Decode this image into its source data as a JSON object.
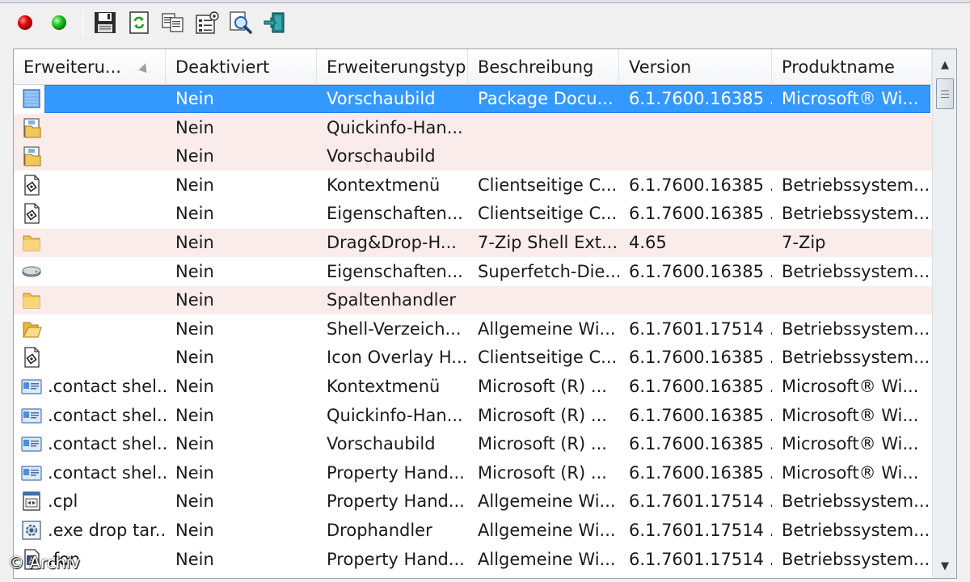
{
  "toolbar": {
    "buttons": [
      {
        "name": "disable-button",
        "icon": "red-dot-icon",
        "color": "#d40000"
      },
      {
        "name": "enable-button",
        "icon": "green-dot-icon",
        "color": "#16b216"
      },
      {
        "name": "save-button",
        "icon": "floppy-disk-icon"
      },
      {
        "name": "refresh-button",
        "icon": "refresh-icon"
      },
      {
        "name": "copy-button",
        "icon": "copy-icon"
      },
      {
        "name": "properties-button",
        "icon": "properties-icon"
      },
      {
        "name": "find-button",
        "icon": "find-icon"
      },
      {
        "name": "exit-button",
        "icon": "exit-icon"
      }
    ]
  },
  "columns": [
    "Erweiteru...",
    "Deaktiviert",
    "Erweiterungstyp",
    "Beschreibung",
    "Version",
    "Produktname"
  ],
  "rows": [
    {
      "icon": "selected-file-icon",
      "name": "",
      "disabled": "Nein",
      "type": "Vorschaubild",
      "desc": "Package Docu...",
      "version": "6.1.7600.16385 ...",
      "product": "Microsoft® Wi...",
      "style": "selected"
    },
    {
      "icon": "folder-handler-icon",
      "name": "",
      "disabled": "Nein",
      "type": "Quickinfo-Han...",
      "desc": "",
      "version": "",
      "product": "",
      "style": "pink"
    },
    {
      "icon": "folder-handler-icon",
      "name": "",
      "disabled": "Nein",
      "type": "Vorschaubild",
      "desc": "",
      "version": "",
      "product": "",
      "style": "pink"
    },
    {
      "icon": "dll-file-icon",
      "name": "",
      "disabled": "Nein",
      "type": "Kontextmenü",
      "desc": "Clientseitige C...",
      "version": "6.1.7600.16385 ...",
      "product": "Betriebssystem...",
      "style": ""
    },
    {
      "icon": "dll-file-icon",
      "name": "",
      "disabled": "Nein",
      "type": "Eigenschaften...",
      "desc": "Clientseitige C...",
      "version": "6.1.7600.16385 ...",
      "product": "Betriebssystem...",
      "style": ""
    },
    {
      "icon": "folder-icon",
      "name": "",
      "disabled": "Nein",
      "type": "Drag&Drop-H...",
      "desc": "7-Zip Shell Ext...",
      "version": "4.65",
      "product": "7-Zip",
      "style": "pink"
    },
    {
      "icon": "drive-icon",
      "name": "",
      "disabled": "Nein",
      "type": "Eigenschaften...",
      "desc": "Superfetch-Die...",
      "version": "6.1.7600.16385 ...",
      "product": "Betriebssystem...",
      "style": ""
    },
    {
      "icon": "folder-icon",
      "name": "",
      "disabled": "Nein",
      "type": "Spaltenhandler",
      "desc": "",
      "version": "",
      "product": "",
      "style": "pink"
    },
    {
      "icon": "open-folder-icon",
      "name": "",
      "disabled": "Nein",
      "type": "Shell-Verzeich...",
      "desc": "Allgemeine Wi...",
      "version": "6.1.7601.17514 ...",
      "product": "Betriebssystem...",
      "style": ""
    },
    {
      "icon": "dll-file-icon",
      "name": "",
      "disabled": "Nein",
      "type": "Icon Overlay H...",
      "desc": "Clientseitige C...",
      "version": "6.1.7600.16385 ...",
      "product": "Betriebssystem...",
      "style": ""
    },
    {
      "icon": "contact-card-icon",
      "name": ".contact shel...",
      "disabled": "Nein",
      "type": "Kontextmenü",
      "desc": "Microsoft (R) ...",
      "version": "6.1.7600.16385 ...",
      "product": "Microsoft® Wi...",
      "style": ""
    },
    {
      "icon": "contact-card-icon",
      "name": ".contact shel...",
      "disabled": "Nein",
      "type": "Quickinfo-Han...",
      "desc": "Microsoft (R) ...",
      "version": "6.1.7600.16385 ...",
      "product": "Microsoft® Wi...",
      "style": ""
    },
    {
      "icon": "contact-card-icon",
      "name": ".contact shel...",
      "disabled": "Nein",
      "type": "Vorschaubild",
      "desc": "Microsoft (R) ...",
      "version": "6.1.7600.16385 ...",
      "product": "Microsoft® Wi...",
      "style": ""
    },
    {
      "icon": "contact-card-icon",
      "name": ".contact shel...",
      "disabled": "Nein",
      "type": "Property Hand...",
      "desc": "Microsoft (R) ...",
      "version": "6.1.7600.16385 ...",
      "product": "Microsoft® Wi...",
      "style": ""
    },
    {
      "icon": "control-panel-icon",
      "name": ".cpl",
      "disabled": "Nein",
      "type": "Property Hand...",
      "desc": "Allgemeine Wi...",
      "version": "6.1.7601.17514 ...",
      "product": "Betriebssystem...",
      "style": ""
    },
    {
      "icon": "exe-gear-icon",
      "name": ".exe drop tar...",
      "disabled": "Nein",
      "type": "Drophandler",
      "desc": "Allgemeine Wi...",
      "version": "6.1.7601.17514 ...",
      "product": "Betriebssystem...",
      "style": ""
    },
    {
      "icon": "fon-file-icon",
      "name": ".fon",
      "disabled": "Nein",
      "type": "Property Hand...",
      "desc": "Allgemeine Wi...",
      "version": "6.1.7601.17514 ...",
      "product": "Betriebssystem...",
      "style": ""
    }
  ],
  "watermark": "© Archiv",
  "colors": {
    "selection": "#3399ff",
    "pink_row": "#fbecec"
  }
}
